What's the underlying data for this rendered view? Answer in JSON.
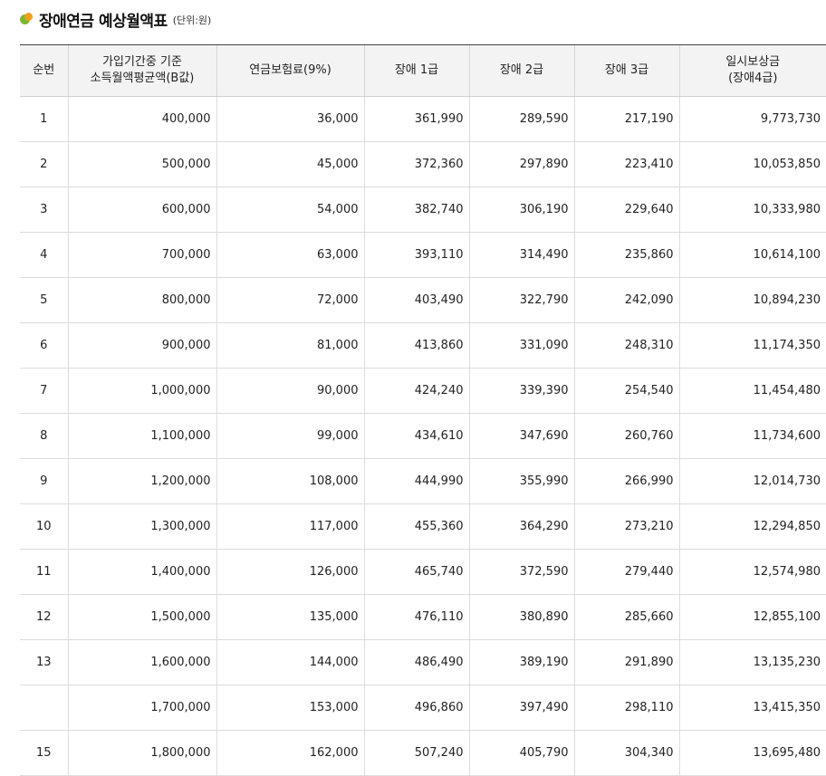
{
  "title": {
    "text": "장애연금 예상월액표",
    "unit": "(단위:원)"
  },
  "table": {
    "headers": {
      "seq": "순번",
      "base_line1": "가입기간중 기준",
      "base_line2": "소득월액평균액(B값)",
      "premium": "연금보험료(9%)",
      "grade1": "장애 1급",
      "grade2": "장애 2급",
      "grade3": "장애 3급",
      "lump_line1": "일시보상금",
      "lump_line2": "(장애4급)"
    },
    "rows": [
      {
        "seq": "1",
        "base": "400,000",
        "premium": "36,000",
        "g1": "361,990",
        "g2": "289,590",
        "g3": "217,190",
        "lump": "9,773,730"
      },
      {
        "seq": "2",
        "base": "500,000",
        "premium": "45,000",
        "g1": "372,360",
        "g2": "297,890",
        "g3": "223,410",
        "lump": "10,053,850"
      },
      {
        "seq": "3",
        "base": "600,000",
        "premium": "54,000",
        "g1": "382,740",
        "g2": "306,190",
        "g3": "229,640",
        "lump": "10,333,980"
      },
      {
        "seq": "4",
        "base": "700,000",
        "premium": "63,000",
        "g1": "393,110",
        "g2": "314,490",
        "g3": "235,860",
        "lump": "10,614,100"
      },
      {
        "seq": "5",
        "base": "800,000",
        "premium": "72,000",
        "g1": "403,490",
        "g2": "322,790",
        "g3": "242,090",
        "lump": "10,894,230"
      },
      {
        "seq": "6",
        "base": "900,000",
        "premium": "81,000",
        "g1": "413,860",
        "g2": "331,090",
        "g3": "248,310",
        "lump": "11,174,350"
      },
      {
        "seq": "7",
        "base": "1,000,000",
        "premium": "90,000",
        "g1": "424,240",
        "g2": "339,390",
        "g3": "254,540",
        "lump": "11,454,480"
      },
      {
        "seq": "8",
        "base": "1,100,000",
        "premium": "99,000",
        "g1": "434,610",
        "g2": "347,690",
        "g3": "260,760",
        "lump": "11,734,600"
      },
      {
        "seq": "9",
        "base": "1,200,000",
        "premium": "108,000",
        "g1": "444,990",
        "g2": "355,990",
        "g3": "266,990",
        "lump": "12,014,730"
      },
      {
        "seq": "10",
        "base": "1,300,000",
        "premium": "117,000",
        "g1": "455,360",
        "g2": "364,290",
        "g3": "273,210",
        "lump": "12,294,850"
      },
      {
        "seq": "11",
        "base": "1,400,000",
        "premium": "126,000",
        "g1": "465,740",
        "g2": "372,590",
        "g3": "279,440",
        "lump": "12,574,980"
      },
      {
        "seq": "12",
        "base": "1,500,000",
        "premium": "135,000",
        "g1": "476,110",
        "g2": "380,890",
        "g3": "285,660",
        "lump": "12,855,100"
      },
      {
        "seq": "13",
        "base": "1,600,000",
        "premium": "144,000",
        "g1": "486,490",
        "g2": "389,190",
        "g3": "291,890",
        "lump": "13,135,230"
      },
      {
        "seq": "",
        "base": "1,700,000",
        "premium": "153,000",
        "g1": "496,860",
        "g2": "397,490",
        "g3": "298,110",
        "lump": "13,415,350"
      },
      {
        "seq": "15",
        "base": "1,800,000",
        "premium": "162,000",
        "g1": "507,240",
        "g2": "405,790",
        "g3": "304,340",
        "lump": "13,695,480"
      }
    ]
  },
  "colors": {
    "bullet_green": "#7cb82f",
    "bullet_orange": "#f0a01e",
    "header_bg": "#f3f3f3"
  }
}
